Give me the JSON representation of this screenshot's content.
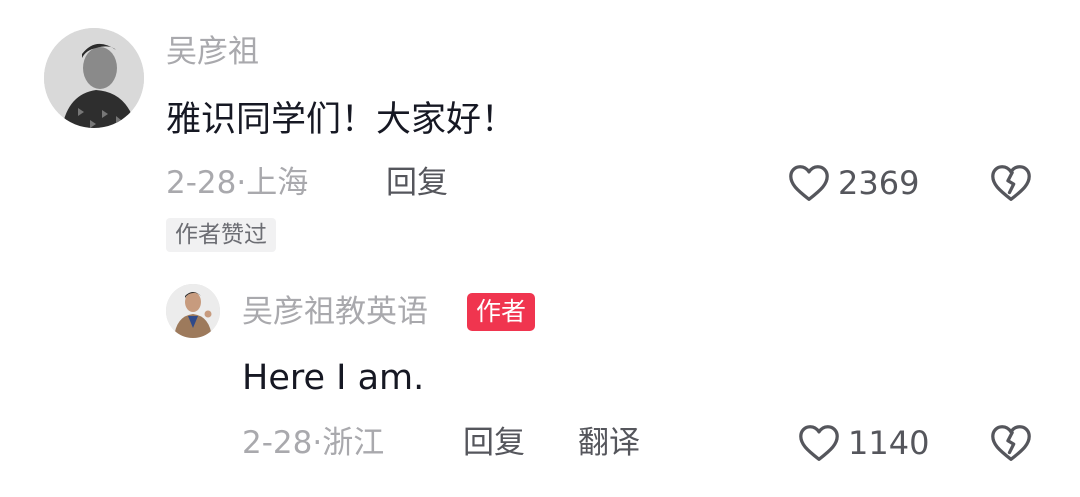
{
  "comment": {
    "username": "吴彦祖",
    "text": "雅识同学们！大家好！",
    "date": "2-28",
    "separator": "·",
    "location": "上海",
    "reply_label": "回复",
    "like_count": "2369",
    "badge": "作者赞过",
    "icons": {
      "like": "heart-outline-icon",
      "dislike": "broken-heart-icon"
    }
  },
  "reply": {
    "username": "吴彦祖教英语",
    "author_badge": "作者",
    "text": "Here I am.",
    "date": "2-28",
    "separator": "·",
    "location": "浙江",
    "reply_label": "回复",
    "translate_label": "翻译",
    "like_count": "1140",
    "icons": {
      "like": "heart-outline-icon",
      "dislike": "broken-heart-icon"
    }
  },
  "colors": {
    "username": "#a9a9ad",
    "text": "#161823",
    "action": "#55565c",
    "author_badge_bg": "#f0354f",
    "liked_badge_bg": "#f1f1f2"
  }
}
